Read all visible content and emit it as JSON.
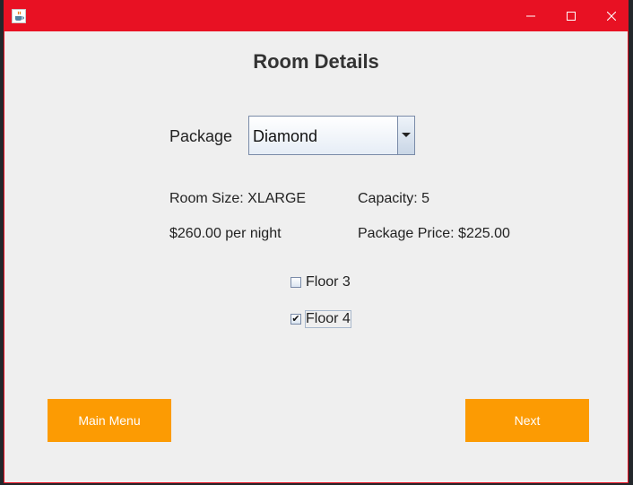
{
  "window": {
    "icon": "java-cup-icon",
    "controls": [
      "minimize-icon",
      "maximize-icon",
      "close-icon"
    ],
    "title_bar_color": "#e81123"
  },
  "heading": "Room Details",
  "package": {
    "label": "Package",
    "selected": "Diamond"
  },
  "details": {
    "room_size": "Room Size: XLARGE",
    "capacity": "Capacity: 5",
    "price_per_night": "$260.00 per night",
    "package_price": "Package Price: $225.00"
  },
  "floors": [
    {
      "label": "Floor 3",
      "checked": false
    },
    {
      "label": "Floor 4",
      "checked": true
    }
  ],
  "buttons": {
    "main_menu": "Main Menu",
    "next": "Next",
    "color": "#fc9b03"
  }
}
